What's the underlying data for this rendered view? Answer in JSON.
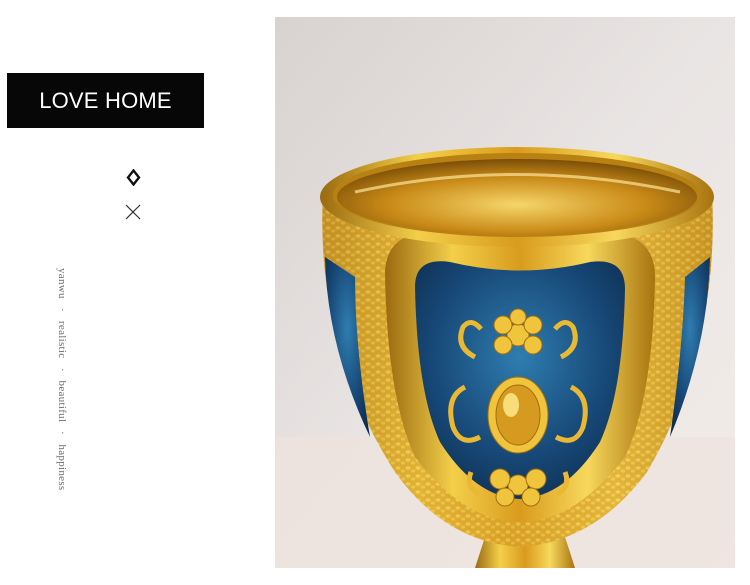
{
  "title": {
    "text": "LOVE HOME"
  },
  "icons": {
    "diamond": "diamond-icon",
    "cross": "cross-icon"
  },
  "tagline": {
    "words": [
      "yanwu",
      "realistic",
      "beautiful",
      "happiness"
    ],
    "separator": "·"
  },
  "photo": {
    "subject": "goblet-photo",
    "colors": {
      "gold": "#e8b62a",
      "enamel": "#1c4a78",
      "background": "#dcd6d3"
    }
  }
}
